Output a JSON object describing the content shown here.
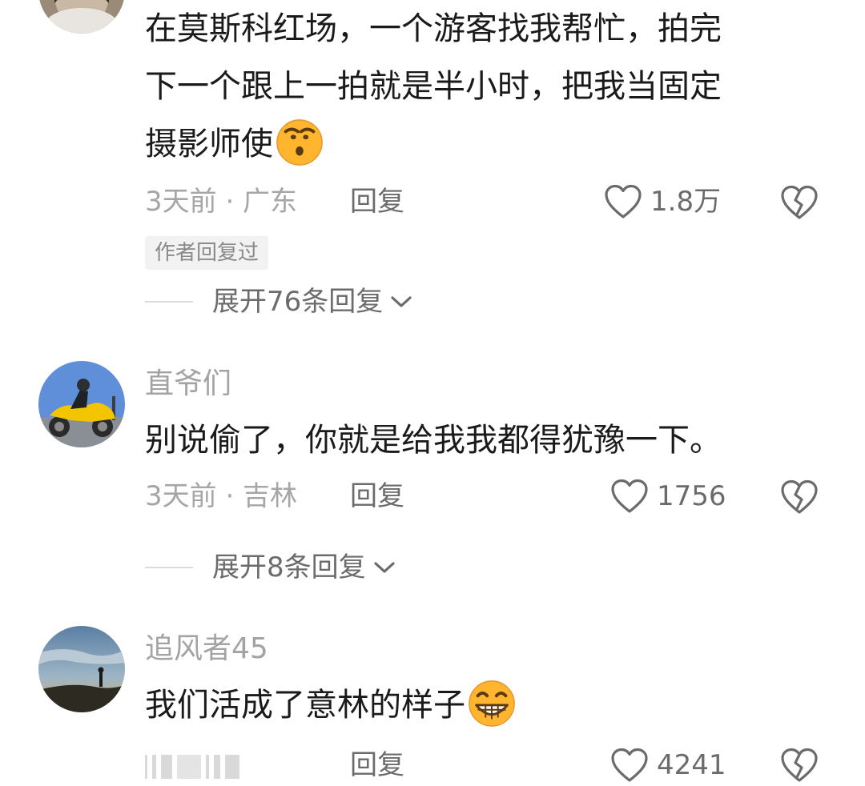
{
  "comments": [
    {
      "username": "",
      "text_lines": [
        "在莫斯科红场，一个游客找我帮忙，拍完",
        "下一个跟上一拍就是半小时，把我当固定",
        "摄影师使"
      ],
      "emoji": "smirk-emoji",
      "time": "3天前",
      "location": "广东",
      "meta": "3天前 · 广东",
      "reply_label": "回复",
      "likes": "1.8万",
      "author_badge": "作者回复过",
      "expand_label": "展开76条回复"
    },
    {
      "username": "直爷们",
      "text_lines": [
        "别说偷了，你就是给我我都得犹豫一下。"
      ],
      "time": "3天前",
      "location": "吉林",
      "meta": "3天前 · 吉林",
      "reply_label": "回复",
      "likes": "1756",
      "expand_label": "展开8条回复"
    },
    {
      "username": "追风者45",
      "text_lines": [
        "我们活成了意林的样子"
      ],
      "emoji": "grin-emoji",
      "reply_label": "回复",
      "likes": "4241"
    }
  ],
  "icons": {
    "like": "heart-outline-icon",
    "dislike": "broken-heart-icon",
    "expand": "chevron-down-icon"
  },
  "colors": {
    "text": "#1a1a1a",
    "muted": "#a6a6a6",
    "action": "#6b6b6b",
    "badge_bg": "#f2f2f2",
    "emoji": "#ffb52e"
  }
}
